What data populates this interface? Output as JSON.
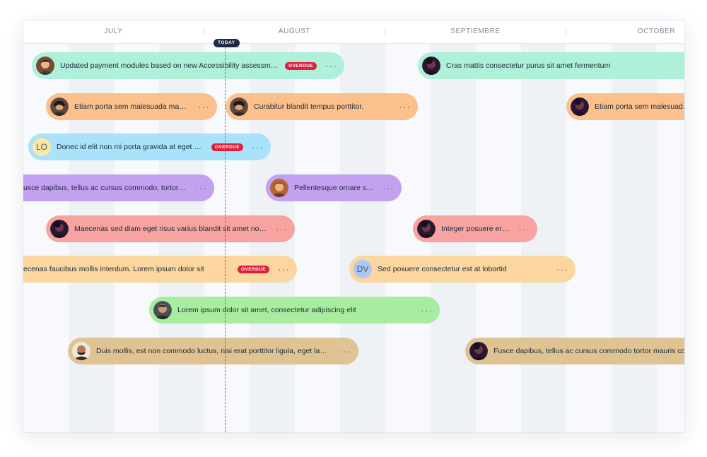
{
  "months": [
    "JULY",
    "AUGUST",
    "SEPTIEMBRE",
    "OCTOBER"
  ],
  "today_label": "TODAY",
  "overdue_label": "OVERDUE",
  "more_label": "···",
  "colors": {
    "mint": "#aef0da",
    "peach": "#fbc08c",
    "sky": "#a9e2fb",
    "lavender": "#c3a1f1",
    "salmon": "#f7a3a0",
    "sand": "#fbd69e",
    "green": "#a8ec9f",
    "tan": "#dfc393"
  },
  "tasks": [
    {
      "text": "Updated payment modules based on new Accessibility assessment",
      "avatar": "photo"
    },
    {
      "text": "Cras mattis consectetur purus sit amet fermentum",
      "avatar": "photo"
    },
    {
      "text": "Etiam porta sem malesuada magna...",
      "avatar": "photo"
    },
    {
      "text": "Curabitur blandit tempus porttitor.",
      "avatar": "photo"
    },
    {
      "text": "Etiam porta sem malesuada m",
      "avatar": "photo"
    },
    {
      "text": "Donec id elit non mi porta gravida at eget metus",
      "avatar": "LO"
    },
    {
      "text": "usce dapibus, tellus ac cursus commodo, tortor ma...",
      "avatar": ""
    },
    {
      "text": "Pellentesque ornare sem...",
      "avatar": "photo"
    },
    {
      "text": "Maecenas sed diam eget risus varius blandit sit amet non m...",
      "avatar": "photo"
    },
    {
      "text": "Integer posuere erat...",
      "avatar": "photo"
    },
    {
      "text": "ecenas faucibus mollis interdum. Lorem ipsum dolor sit",
      "avatar": ""
    },
    {
      "text": "Sed posuere consectetur est at lobortid",
      "avatar": "DV"
    },
    {
      "text": "Lorem ipsum dolor sit amet, consectetur adipiscing elit",
      "avatar": "photo"
    },
    {
      "text": "Duis mollis, est non commodo luctus, nisi erat porttitor ligula, eget lacinia ...",
      "avatar": "photo"
    },
    {
      "text": "Fusce dapibus, tellus ac cursus commodo tortor mauris cond",
      "avatar": "photo"
    }
  ]
}
